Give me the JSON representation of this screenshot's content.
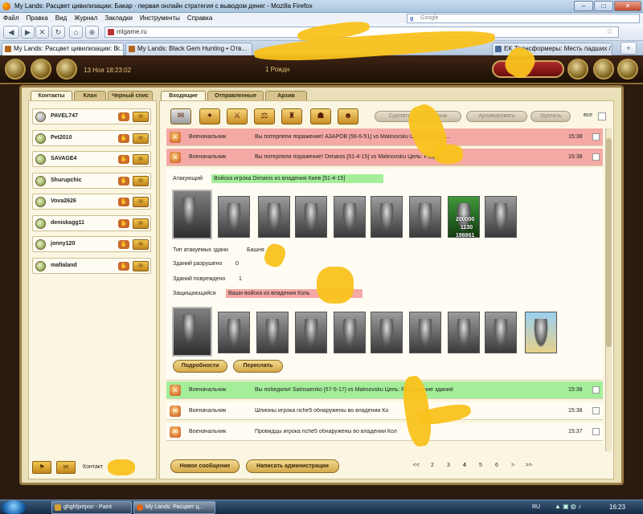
{
  "browser": {
    "title": "My Lands: Расцвет цивилизации: Бакар - первая онлайн стратегия с выводом денег - Mozilla Firefox",
    "menu": [
      "Файл",
      "Правка",
      "Вид",
      "Журнал",
      "Закладки",
      "Инструменты",
      "Справка"
    ],
    "search_placeholder": "Google",
    "url": "mlgame.ru",
    "tabs": [
      {
        "label": "My Lands: Расцвет цивилизации: Б...",
        "active": true
      },
      {
        "label": "My Lands: Black Gem Hunting • Отв...",
        "active": false
      },
      {
        "label": "EK Трансформеры: Месть падших / Tr...",
        "active": false
      }
    ]
  },
  "game": {
    "datetime": "13 Ноя 18:23:02",
    "center_label": "1 Рождн",
    "left_tabs": [
      "Контакты",
      "Клан",
      "Черный спис"
    ],
    "contacts": [
      "PAVEL747",
      "Pet2010",
      "SAVAGE4",
      "Shurupchic",
      "Vova2626",
      "deniskagg11",
      "jonny120",
      "mafialand"
    ],
    "contacts_footer": "Контакт",
    "right_tabs": [
      "Входящие",
      "Отправленные",
      "Архив"
    ],
    "toolbar": {
      "mark_read": "Сделать прочитанным",
      "archive": "Архивировать",
      "delete": "Удалить",
      "all": "все"
    },
    "messages": [
      {
        "sender": "Военачальник",
        "text": "Вы потерпели поражение! АЗАРОВ [56-6-51] vs Malinovsku  Цель: Разруш...",
        "time": "15:38",
        "style": "red"
      },
      {
        "sender": "Военачальник",
        "text": "Вы потерпели поражение! Dimanis [51-4-15] vs Malinovsku  Цель: Разруш...",
        "time": "15:38",
        "style": "red"
      },
      {
        "sender": "Военачальник",
        "text": "Вы победили! Satrisaenko [57-5-17] vs Malinovsku  Цель: Разрушение зданий",
        "time": "15:38",
        "style": "green"
      },
      {
        "sender": "Военачальник",
        "text": "Шпионы игрока riche5 обнаружены во владении Ко",
        "time": "15:38",
        "style": "plain"
      },
      {
        "sender": "Военачальник",
        "text": "Провидцы игрока riche5 обнаружены во владении Кол",
        "time": "15:37",
        "style": "plain"
      }
    ],
    "detail": {
      "attacker_label": "Атакующий",
      "attacker_value": "Войска игрока Dimanis из владения Киев [51-4-15]",
      "building_type_label": "Тип атакуемых здани",
      "building_type_value": "Башня",
      "destroyed_label": "Зданий разрушено",
      "destroyed_value": "0",
      "damaged_label": "Зданий повреждено",
      "damaged_value": "1",
      "defender_label": "Защищающийся",
      "defender_value": "Ваши войска из владения Коль",
      "unit_stats": [
        "200000",
        "1130",
        "198861"
      ],
      "details_button": "Подробности",
      "forward_button": "Переслать"
    },
    "new_message_button": "Новое сообщение",
    "write_admin_button": "Написать администрации",
    "pager": [
      "<<",
      "2",
      "3",
      "4",
      "5",
      "6",
      ">",
      ">>"
    ],
    "pager_current": "4"
  },
  "taskbar": {
    "tasks": [
      "ghghfjxrtjxsr - Paint",
      "My Lands: Расцвет ц..."
    ],
    "lang": "RU",
    "clock": "16:23"
  },
  "colors": {
    "defeat": "#f4a9a4",
    "victory": "#a4ee9a",
    "scribble": "#f9c21c"
  }
}
